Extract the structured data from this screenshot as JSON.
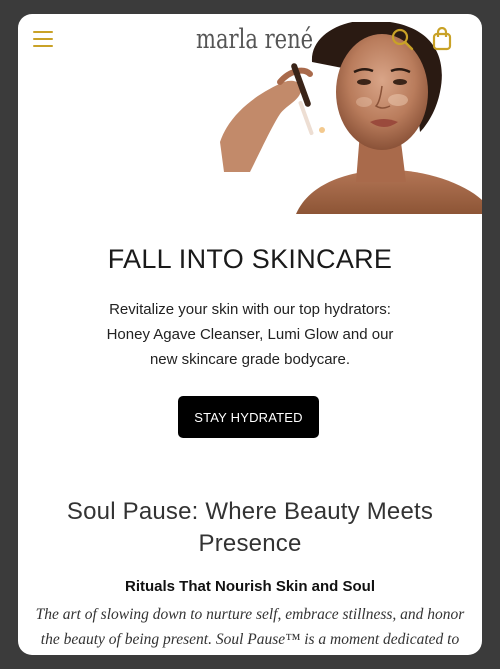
{
  "header": {
    "logo": "marla rené",
    "menu_icon": "hamburger-menu-icon",
    "search_icon": "search-icon",
    "cart_icon": "shopping-bag-icon",
    "accent_color": "#c9a227"
  },
  "hero": {
    "image_alt": "woman applying serum with dropper",
    "title": "FALL INTO SKINCARE",
    "description": "Revitalize your skin with our top hydrators: Honey Agave Cleanser, Lumi Glow and our new skincare grade bodycare.",
    "button_label": "STAY HYDRATED"
  },
  "section": {
    "title": "Soul Pause: Where Beauty Meets Presence",
    "subtitle": "Rituals That Nourish Skin and Soul",
    "body": "The art of slowing down to nurture self, embrace stillness, and honor the beauty of being present. Soul Pause™ is a moment dedicated to"
  }
}
